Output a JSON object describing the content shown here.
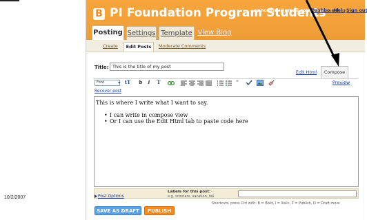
{
  "slide": {
    "date": "10/2/2007"
  },
  "header": {
    "logo_letter": "B",
    "blog_title": "PI Foundation Program Students",
    "email": "vancestev@gmail.com",
    "links": [
      "Dashboard",
      "Help",
      "Sign out"
    ],
    "separator": "|"
  },
  "main_tabs": [
    {
      "label": "Posting",
      "active": true
    },
    {
      "label": "Settings",
      "active": false
    },
    {
      "label": "Template",
      "active": false
    },
    {
      "label": "View Blog",
      "active": false
    }
  ],
  "sub_tabs": [
    {
      "label": "Create",
      "active": false
    },
    {
      "label": "Edit Posts",
      "active": true
    },
    {
      "label": "Moderate Comments",
      "active": false
    }
  ],
  "post": {
    "title_label": "Title:",
    "title_value": "This is the title of my post",
    "editor_line": "This is where I write what I want to say.",
    "editor_bullets": [
      "I can write in compose view",
      "Or I can use the Edit Html tab to paste code here"
    ]
  },
  "editor_modes": [
    {
      "label": "Edit Html",
      "active": false
    },
    {
      "label": "Compose",
      "active": true
    }
  ],
  "toolbar": {
    "font_select": "Font",
    "preview": "Preview",
    "recover": "Recover post",
    "icons": [
      "font-size-icon",
      "bold-icon",
      "italic-icon",
      "text-color-icon",
      "link-icon",
      "align-left-icon",
      "align-center-icon",
      "align-right-icon",
      "align-justify-icon",
      "numbered-list-icon",
      "bullet-list-icon",
      "blockquote-icon",
      "spellcheck-icon",
      "image-icon",
      "remove-format-icon"
    ]
  },
  "labels": {
    "post_options": "Post Options",
    "caption": "Labels for this post:",
    "hint": "e.g. scooters, vacation, fall"
  },
  "shortcuts": "Shortcuts: press Ctrl with: B = Bold, I = Italic, P = Publish, D = Draft more",
  "buttons": {
    "save_draft": "SAVE AS DRAFT",
    "publish": "PUBLISH"
  },
  "colors": {
    "header_orange": "#f2a13a",
    "link_blue": "#1a3aa8",
    "draft_blue": "#5aa0e6",
    "publish_orange": "#f58a1f"
  }
}
